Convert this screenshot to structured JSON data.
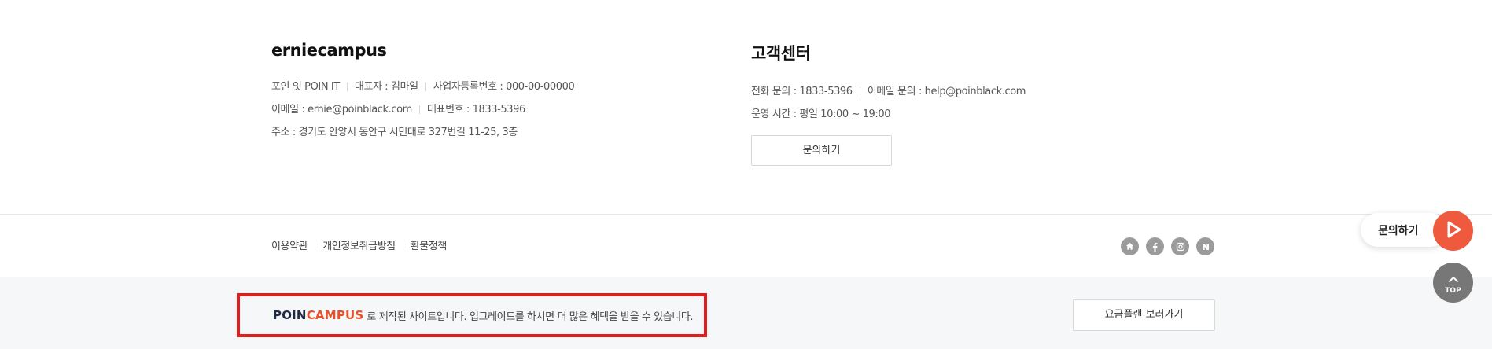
{
  "company": {
    "name": "erniecampus",
    "lines": [
      [
        "포인 잇 POIN IT",
        "대표자 : 김마일",
        "사업자등록번호 : 000-00-00000"
      ],
      [
        "이메일 : ernie@poinblack.com",
        "대표번호 : 1833-5396"
      ],
      [
        "주소 : 경기도 안양시 동안구 시민대로 327번길 11-25, 3층"
      ]
    ]
  },
  "customer_center": {
    "title": "고객센터",
    "phone": "전화 문의 : 1833-5396",
    "email": "이메일 문의 : help@poinblack.com",
    "hours": "운영 시간 : 평일 10:00 ~ 19:00",
    "inquiry_button": "문의하기"
  },
  "policy_links": [
    "이용약관",
    "개인정보취급방침",
    "환불정책"
  ],
  "social_icons": [
    "home-icon",
    "facebook-icon",
    "instagram-icon",
    "naver-icon"
  ],
  "promo": {
    "logo_poin": "POIN",
    "logo_campus": "CAMPUS",
    "text": "로 제작된 사이트입니다. 업그레이드를 하시면 더 많은 혜택을 받을 수 있습니다.",
    "plan_button": "요금플랜 보러가기",
    "highlight_color": "#e21b1b"
  },
  "floating": {
    "chat_label": "문의하기",
    "top_label": "TOP",
    "chat_color": "#ef5a3f"
  }
}
